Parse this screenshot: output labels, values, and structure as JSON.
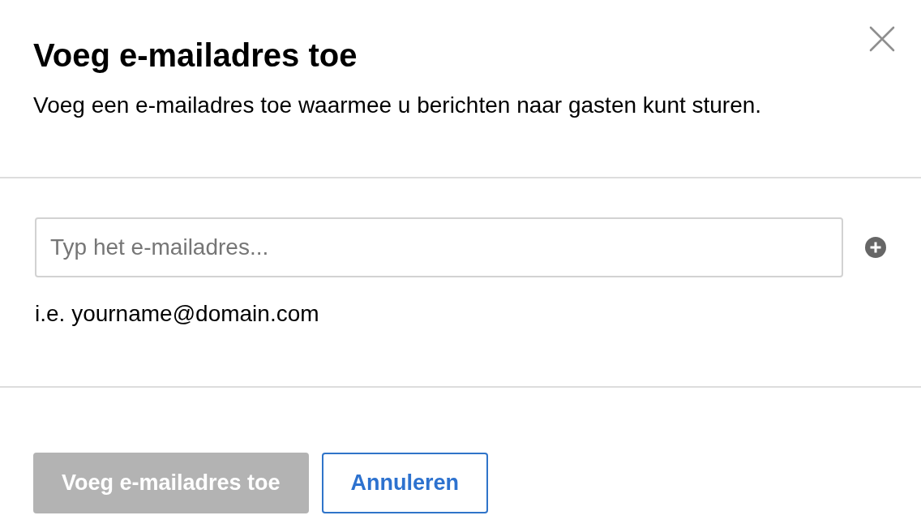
{
  "dialog": {
    "title": "Voeg e-mailadres toe",
    "description": "Voeg een e-mailadres toe waarmee u berichten naar gasten kunt sturen.",
    "email_field": {
      "placeholder": "Typ het e-mailadres..."
    },
    "hint": "i.e. yourname@domain.com",
    "buttons": [
      {
        "label": "Voeg e-mailadres toe",
        "kind": "primary",
        "disabled": true
      },
      {
        "label": "Annuleren",
        "kind": "secondary",
        "disabled": false
      }
    ]
  }
}
